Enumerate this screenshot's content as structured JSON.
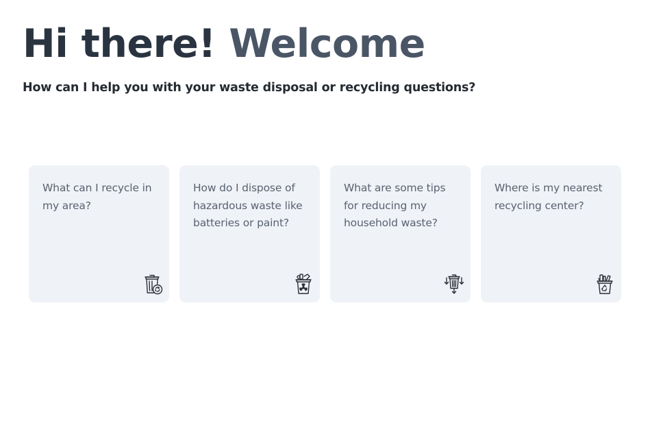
{
  "header": {
    "greeting_part1": "Hi there!",
    "greeting_part2": "Welcome",
    "subtitle": "How can I help you with your waste disposal or recycling questions?"
  },
  "suggestions": [
    {
      "text": "What can I recycle in my area?",
      "icon": "recycle-bin-icon"
    },
    {
      "text": "How do I dispose of hazardous waste like batteries or paint?",
      "icon": "hazardous-waste-bin-icon"
    },
    {
      "text": "What are some tips for reducing my household waste?",
      "icon": "waste-reduction-icon"
    },
    {
      "text": "Where is my nearest recycling center?",
      "icon": "recycling-center-bin-icon"
    }
  ],
  "colors": {
    "background": "#ffffff",
    "card_background": "#eff2f7",
    "heading_dark": "#2a3441",
    "heading_light": "#4a5566",
    "card_text": "#5a6270"
  }
}
